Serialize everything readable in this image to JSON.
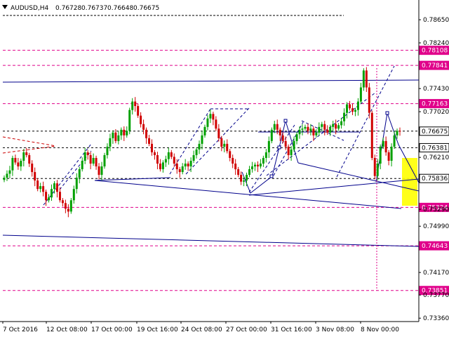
{
  "header": {
    "symbol": "AUDUSD,H4",
    "ohlc": [
      "0.76728",
      "0.76737",
      "0.76648",
      "0.76675"
    ]
  },
  "chart_data": {
    "type": "candlestick",
    "symbol": "AUDUSD",
    "timeframe": "H4",
    "ylim": [
      0.733,
      0.7895
    ],
    "y_ticks": [
      "0.78650",
      "0.78240",
      "0.77430",
      "0.77020",
      "0.76210",
      "0.75290",
      "0.74990",
      "0.74170",
      "0.73770",
      "0.73360"
    ],
    "x_ticks": [
      "7 Oct 2016",
      "12 Oct 08:00",
      "17 Oct 00:00",
      "19 Oct 16:00",
      "24 Oct 08:00",
      "27 Oct 00:00",
      "31 Oct 16:00",
      "3 Nov 08:00",
      "8 Nov 00:00"
    ],
    "price_levels": [
      {
        "label": "0.78108",
        "value": 0.78108,
        "color": "#e0008a"
      },
      {
        "label": "0.77841",
        "value": 0.77841,
        "color": "#e0008a"
      },
      {
        "label": "0.77163",
        "value": 0.77163,
        "color": "#e0008a"
      },
      {
        "label": "0.76675",
        "value": 0.76675,
        "color": "#000000"
      },
      {
        "label": "0.76381",
        "value": 0.76381,
        "color": "#000000"
      },
      {
        "label": "0.75836",
        "value": 0.75836,
        "color": "#000000"
      },
      {
        "label": "0.75324",
        "value": 0.75324,
        "color": "#e0008a"
      },
      {
        "label": "0.74643",
        "value": 0.74643,
        "color": "#e0008a"
      },
      {
        "label": "0.73851",
        "value": 0.73851,
        "color": "#e0008a"
      }
    ],
    "candles_close": [
      0.7585,
      0.7592,
      0.7598,
      0.762,
      0.7612,
      0.7605,
      0.7615,
      0.763,
      0.7625,
      0.761,
      0.7595,
      0.758,
      0.7565,
      0.757,
      0.756,
      0.7545,
      0.755,
      0.7565,
      0.7575,
      0.756,
      0.7545,
      0.754,
      0.753,
      0.7525,
      0.7545,
      0.7565,
      0.7585,
      0.76,
      0.7615,
      0.763,
      0.7625,
      0.761,
      0.762,
      0.7605,
      0.759,
      0.7605,
      0.7625,
      0.764,
      0.7655,
      0.7665,
      0.765,
      0.766,
      0.767,
      0.766,
      0.7668,
      0.7705,
      0.772,
      0.7712,
      0.7695,
      0.768,
      0.767,
      0.7655,
      0.7645,
      0.763,
      0.7625,
      0.761,
      0.76,
      0.7612,
      0.7618,
      0.763,
      0.7622,
      0.761,
      0.76,
      0.7595,
      0.7605,
      0.761,
      0.7605,
      0.7615,
      0.7625,
      0.7635,
      0.7645,
      0.766,
      0.7675,
      0.769,
      0.7698,
      0.7688,
      0.7672,
      0.7655,
      0.764,
      0.7645,
      0.7632,
      0.762,
      0.761,
      0.76,
      0.759,
      0.7578,
      0.758,
      0.759,
      0.76,
      0.7605,
      0.7608,
      0.7605,
      0.761,
      0.762,
      0.763,
      0.765,
      0.767,
      0.768,
      0.767,
      0.766,
      0.765,
      0.764,
      0.7625,
      0.7635,
      0.765,
      0.7662,
      0.767,
      0.7672,
      0.7675,
      0.7668,
      0.7672,
      0.766,
      0.7665,
      0.7675,
      0.768,
      0.767,
      0.7665,
      0.7675,
      0.768,
      0.7672,
      0.7678,
      0.7685,
      0.77,
      0.7715,
      0.7708,
      0.7702,
      0.7705,
      0.772,
      0.7745,
      0.7775,
      0.7745,
      0.77,
      0.762,
      0.7588,
      0.761,
      0.764,
      0.765,
      0.763,
      0.7615,
      0.764,
      0.766,
      0.7668,
      0.76675
    ]
  }
}
